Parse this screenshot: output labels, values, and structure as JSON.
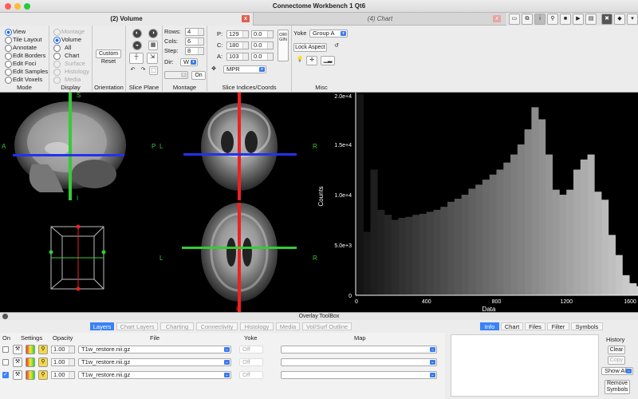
{
  "window": {
    "title": "Connectome Workbench 1 Qt6"
  },
  "tabs": [
    {
      "label": "(2) Volume",
      "close": "x"
    },
    {
      "label": "(4) Chart",
      "close": "x"
    }
  ],
  "toolbar_icons": [
    "info-icon",
    "i-icon",
    "pin-icon",
    "camera-icon",
    "movie-icon",
    "film-icon",
    "settings-icon",
    "layers-icon",
    "dropdown-icon"
  ],
  "mode": {
    "label": "Mode",
    "options": [
      "View",
      "Tile Layout",
      "Annotate",
      "Edit Borders",
      "Edit Foci",
      "Edit Samples",
      "Edit Voxels"
    ],
    "selected": "View"
  },
  "display": {
    "label": "Display",
    "options": [
      "Montage",
      "Volume",
      "All",
      "Chart",
      "Surface",
      "Histology",
      "Media"
    ],
    "selected": "Volume"
  },
  "orientation": {
    "label": "Orientation",
    "custom": "Custom",
    "reset": "Reset"
  },
  "slice_plane": {
    "label": "Slice Plane"
  },
  "montage": {
    "label": "Montage",
    "rows_label": "Rows:",
    "rows": "4",
    "cols_label": "Cols:",
    "cols": "6",
    "step_label": "Step:",
    "step": "8",
    "dir_label": "Dir:",
    "dir": "W",
    "on_button": "On"
  },
  "slice_indices": {
    "label": "Slice Indices/Coords",
    "p_label": "P:",
    "p": "129",
    "p_coord": "0.0",
    "c_label": "C:",
    "c": "180",
    "c_coord": "0.0",
    "a_label": "A:",
    "a": "103",
    "a_coord": "0.0",
    "origin": "ORIGIN",
    "projection": "MPR"
  },
  "misc": {
    "label": "Misc",
    "yoke_label": "Yoke",
    "yoke_value": "Group A",
    "lock_aspect": "Lock Aspect"
  },
  "viewport": {
    "sagittal": {
      "top": "S",
      "bottom": "I",
      "left": "A",
      "right": "P"
    },
    "coronal": {
      "left": "L",
      "right": "R"
    },
    "axial": {
      "top": "A",
      "bottom": "P",
      "left": "L",
      "right": "R"
    }
  },
  "chart_data": {
    "type": "bar",
    "xlabel": "Data",
    "ylabel": "Counts",
    "xlim": [
      0,
      1600
    ],
    "ylim": [
      0,
      20000
    ],
    "xticks": [
      "0",
      "400",
      "800",
      "1200",
      "1600"
    ],
    "yticks": [
      "0",
      "5.0e+3",
      "1.0e+4",
      "1.5e+4",
      "2.0e+4"
    ],
    "bin_width": 40,
    "values": [
      20000,
      6300,
      12500,
      8500,
      8000,
      7500,
      7700,
      7800,
      8000,
      8100,
      8300,
      8500,
      8800,
      9300,
      9600,
      10000,
      10600,
      11000,
      11500,
      12000,
      12500,
      13200,
      14000,
      15000,
      16500,
      18700,
      17500,
      14000,
      10500,
      10000,
      10500,
      12500,
      13500,
      14000,
      10300,
      9500,
      6000,
      4000,
      2000,
      1200,
      900,
      700,
      600,
      550,
      500,
      450,
      420,
      380,
      350,
      320,
      300,
      280,
      260,
      250,
      240,
      230,
      220,
      210,
      200,
      190,
      180,
      170,
      160,
      150,
      140,
      130,
      120,
      110,
      100,
      90,
      80,
      70,
      60,
      55,
      50,
      45,
      40,
      35,
      30,
      25
    ]
  },
  "overlay": {
    "title": "Overlay ToolBox",
    "tabs": [
      "Layers",
      "Chart Layers",
      "Charting",
      "Connectivity",
      "Histology",
      "Media",
      "Vol/Surf Outline"
    ],
    "active_tab": "Layers",
    "headers": {
      "on": "On",
      "settings": "Settings",
      "opacity": "Opacity",
      "file": "File",
      "yoke": "Yoke",
      "map": "Map"
    },
    "layers": [
      {
        "on": false,
        "opacity": "1.00",
        "file": "T1w_restore.nii.gz",
        "yoke": "Off"
      },
      {
        "on": false,
        "opacity": "1.00",
        "file": "T1w_restore.nii.gz",
        "yoke": "Off"
      },
      {
        "on": true,
        "opacity": "1.00",
        "file": "T1w_restore.nii.gz",
        "yoke": "Off"
      }
    ]
  },
  "info_panel": {
    "tabs": [
      "Info",
      "Chart",
      "Files",
      "Filter",
      "Symbols"
    ],
    "active_tab": "Info",
    "history_label": "History",
    "clear": "Clear",
    "copy": "Copy",
    "show": "Show All",
    "remove_symbols": "Remove Symbols"
  },
  "colors": {
    "accent": "#3b82f6",
    "close": "#e06050",
    "crosshair_green": "#33cc33",
    "crosshair_red": "#ee2020",
    "crosshair_blue": "#2233ee"
  }
}
